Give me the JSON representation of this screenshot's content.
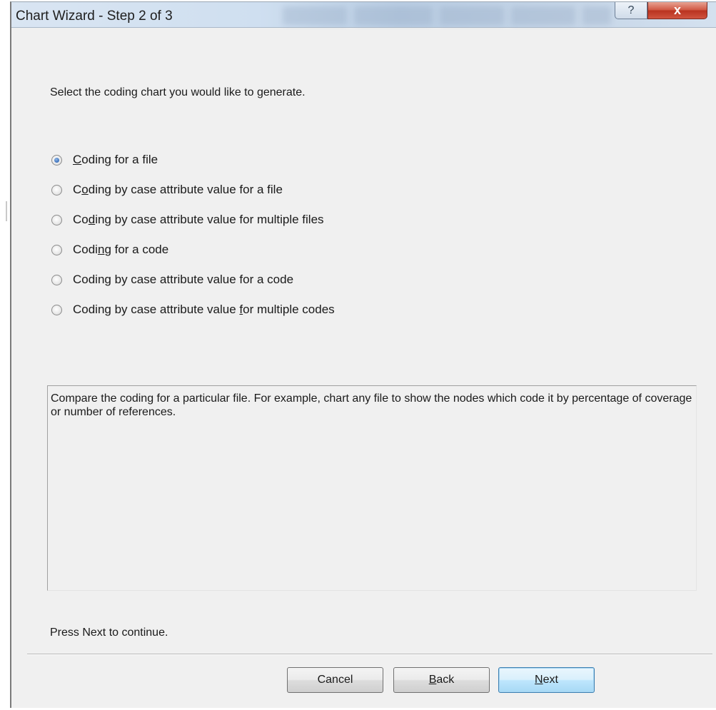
{
  "window": {
    "title": "Chart Wizard - Step 2 of 3",
    "help_glyph": "?",
    "close_glyph": "x"
  },
  "instruction": "Select the coding chart you would like to generate.",
  "options": [
    {
      "pre": "",
      "accel": "C",
      "post": "oding for a file",
      "checked": true
    },
    {
      "pre": "C",
      "accel": "o",
      "post": "ding by case attribute value for a file",
      "checked": false
    },
    {
      "pre": "Co",
      "accel": "d",
      "post": "ing by case attribute value for multiple files",
      "checked": false
    },
    {
      "pre": "Codi",
      "accel": "n",
      "post": "g for a code",
      "checked": false
    },
    {
      "pre": "Codin",
      "accel": "g",
      "post": " by case attribute value for a code",
      "checked": false
    },
    {
      "pre": "Coding by case attribute value ",
      "accel": "f",
      "post": "or multiple codes",
      "checked": false
    }
  ],
  "description": "Compare the coding for a particular file. For example, chart any file to show the nodes which code it by percentage of coverage or number of references.",
  "footer_hint": "Press Next to continue.",
  "buttons": {
    "cancel": {
      "label": "Cancel"
    },
    "back": {
      "accel": "B",
      "rest": "ack"
    },
    "next": {
      "accel": "N",
      "rest": "ext"
    }
  }
}
